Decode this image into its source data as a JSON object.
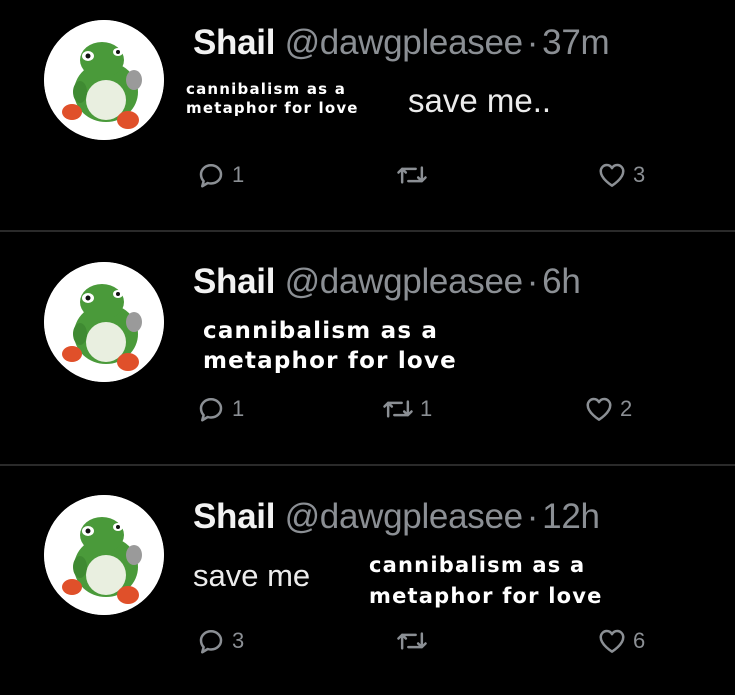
{
  "tweets": [
    {
      "display_name": "Shail",
      "handle": "@dawgpleasee",
      "separator": "·",
      "time": "37m",
      "caption": [
        "cannibalism as a",
        "metaphor for love"
      ],
      "body": "save me..",
      "replies": "1",
      "retweets": "",
      "likes": "3"
    },
    {
      "display_name": "Shail",
      "handle": "@dawgpleasee",
      "separator": "·",
      "time": "6h",
      "caption": [
        "cannibalism as a",
        "metaphor for love"
      ],
      "body": "",
      "replies": "1",
      "retweets": "1",
      "likes": "2"
    },
    {
      "display_name": "Shail",
      "handle": "@dawgpleasee",
      "separator": "·",
      "time": "12h",
      "caption": [
        "cannibalism as a",
        "metaphor for love"
      ],
      "body": "save me",
      "replies": "3",
      "retweets": "",
      "likes": "6"
    }
  ],
  "icons": {
    "avatar": "green-dinosaur-avatar",
    "reply": "reply-icon",
    "retweet": "retweet-icon",
    "like": "heart-icon"
  },
  "colors": {
    "background": "#000000",
    "muted": "#8b8f94",
    "text": "#ececec",
    "divider": "#2a2a2a"
  }
}
